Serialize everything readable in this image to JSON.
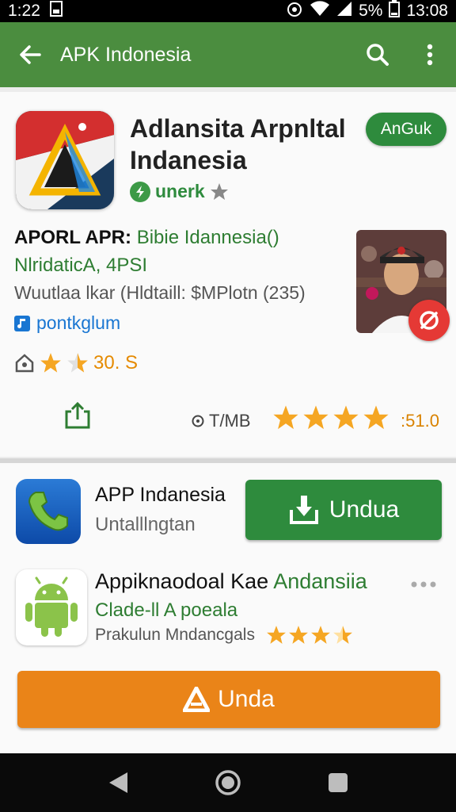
{
  "status_bar": {
    "time": "1:22",
    "battery": "5%",
    "clock": "13:08"
  },
  "app_bar": {
    "title": "APK Indonesia"
  },
  "detail": {
    "title": "Adlansita Arpnltal Indanesia",
    "get_label": "AnGuk",
    "developer": "unerk",
    "line1_bold": "APORL APR:",
    "line1_rest": "Bibie Idannesia()",
    "line2": "NlridaticA, 4PSI",
    "line3": "Wuutlaa lkar (Hldtaill: $MPlotn (235)",
    "link": "pontkglum",
    "rating": "30. S",
    "size": "T/MB",
    "score": ":51.0",
    "stars": 4
  },
  "list": [
    {
      "title": "APP Indanesia",
      "subtitle": "Untalllngtan",
      "button": "Undua"
    },
    {
      "title_a": "Appiknaodoal Kae",
      "title_b": "Andansiia",
      "subtitle": "Clade-ll A poeala",
      "meta": "Prakulun Mndancgals",
      "stars": 4
    }
  ],
  "cta": {
    "label": "Unda"
  },
  "colors": {
    "brand_green": "#4b8d3f",
    "button_green": "#2e8b3d",
    "orange": "#ea8418",
    "star": "#f5a623"
  }
}
